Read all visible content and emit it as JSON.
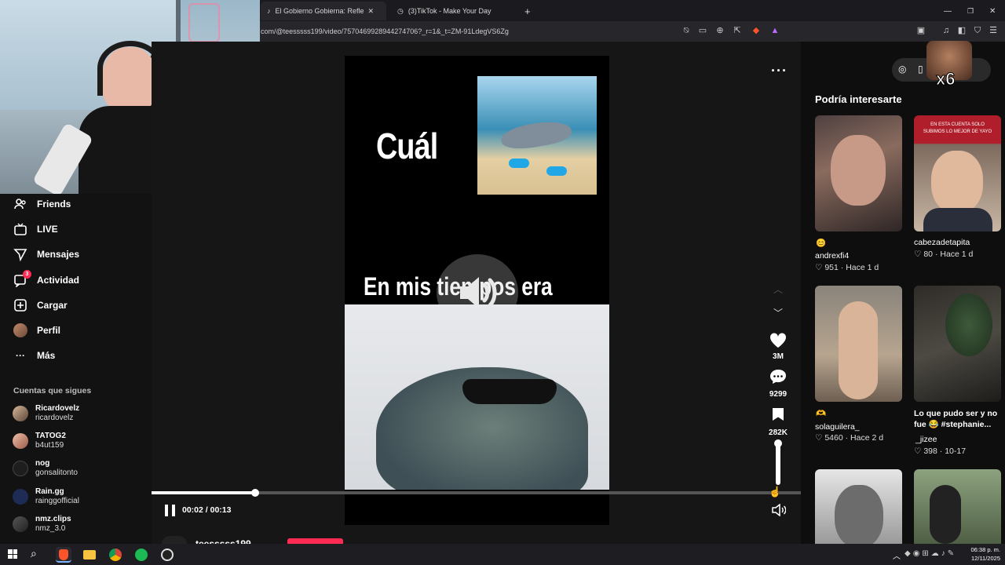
{
  "browser": {
    "tabs": [
      {
        "label": "El Gobierno Gobierna: Reflexione",
        "active": true
      },
      {
        "label": "(3)TikTok - Make Your Day",
        "active": false
      }
    ],
    "url": "com/@teesssss199/video/7570469928944274706?_r=1&_t=ZM-91LdegVS6Zg"
  },
  "sidebar": {
    "items": [
      {
        "label": "Friends",
        "icon": "friends-icon"
      },
      {
        "label": "LIVE",
        "icon": "live-icon"
      },
      {
        "label": "Mensajes",
        "icon": "messages-icon"
      },
      {
        "label": "Actividad",
        "icon": "activity-icon",
        "badge": "3"
      },
      {
        "label": "Cargar",
        "icon": "upload-icon"
      },
      {
        "label": "Perfil",
        "icon": "profile-icon"
      },
      {
        "label": "Más",
        "icon": "more-icon"
      }
    ],
    "following_title": "Cuentas que sigues",
    "following": [
      {
        "name": "Ricardovelz",
        "handle": "ricardovelz"
      },
      {
        "name": "TATOG2",
        "handle": "b4ut159"
      },
      {
        "name": "nog",
        "handle": "gonsalitonto"
      },
      {
        "name": "Rain.gg",
        "handle": "rainggofficial"
      },
      {
        "name": "nmz.clips",
        "handle": "nmz_3.0"
      }
    ]
  },
  "video": {
    "top_text": "Cuál",
    "mid_text": "En mis tiempos era",
    "time_display": "00:02 / 00:13",
    "progress": 0.16,
    "volume_level": 0.92,
    "author": "teesssss199"
  },
  "actions": {
    "likes": "3M",
    "comments": "9299",
    "saves": "282K"
  },
  "recommendations": {
    "title": "Podría interesarte",
    "items": [
      {
        "caption": "😊",
        "author": "andrexfi4",
        "likes": "951",
        "time": "Hace 1 d"
      },
      {
        "caption": "",
        "author": "cabezadetapita",
        "likes": "80",
        "time": "Hace 1 d",
        "overlay": "EN ESTA CUENTA SOLO SUBIMOS LO MEJOR DE YAYO"
      },
      {
        "caption": "🫶",
        "author": "solaguilera_",
        "likes": "5460",
        "time": "Hace 2 d"
      },
      {
        "caption": "Lo que pudo ser y no fue 😂 #stephanie...",
        "author": "_jizee",
        "likes": "398",
        "time": "10-17"
      }
    ]
  },
  "overlay_badge": "x6",
  "taskbar": {
    "time": "06:38 p. m.",
    "date": "12/11/2025"
  }
}
